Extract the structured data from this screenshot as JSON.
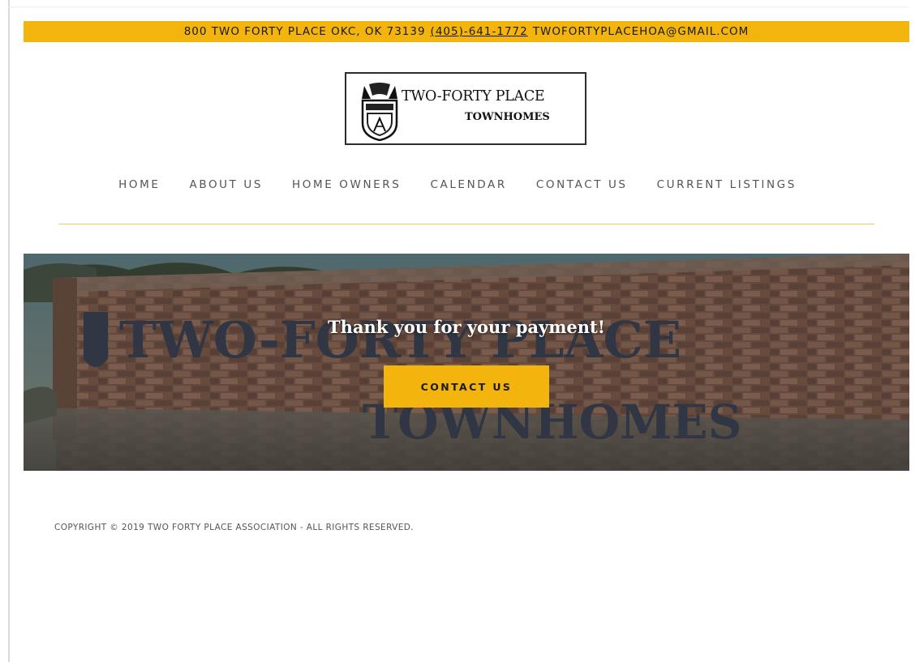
{
  "topbar": {
    "address": "800 TWO FORTY PLACE OKC, OK 73139",
    "phone": "(405)-641-1772",
    "email": "TWOFORTYPLACEHOA@GMAIL.COM"
  },
  "logo": {
    "line1": "TWO-FORTY PLACE",
    "line2": "TOWNHOMES"
  },
  "nav": {
    "items": [
      {
        "label": "HOME"
      },
      {
        "label": "ABOUT US"
      },
      {
        "label": "HOME OWNERS"
      },
      {
        "label": "CALENDAR"
      },
      {
        "label": "CONTACT US"
      },
      {
        "label": "CURRENT LISTINGS"
      }
    ]
  },
  "hero": {
    "title": "Thank you for your payment!",
    "button_label": "CONTACT US",
    "sign_text_line1": "TWO-FORTY PLACE",
    "sign_text_line2": "TOWNHOMES"
  },
  "footer": {
    "copyright": "COPYRIGHT © 2019 TWO FORTY PLACE ASSOCIATION - ALL RIGHTS RESERVED."
  },
  "colors": {
    "accent": "#f3b50d",
    "nav_text": "#555555",
    "rule": "#e6c96b",
    "brick": "#7a5a4a"
  }
}
